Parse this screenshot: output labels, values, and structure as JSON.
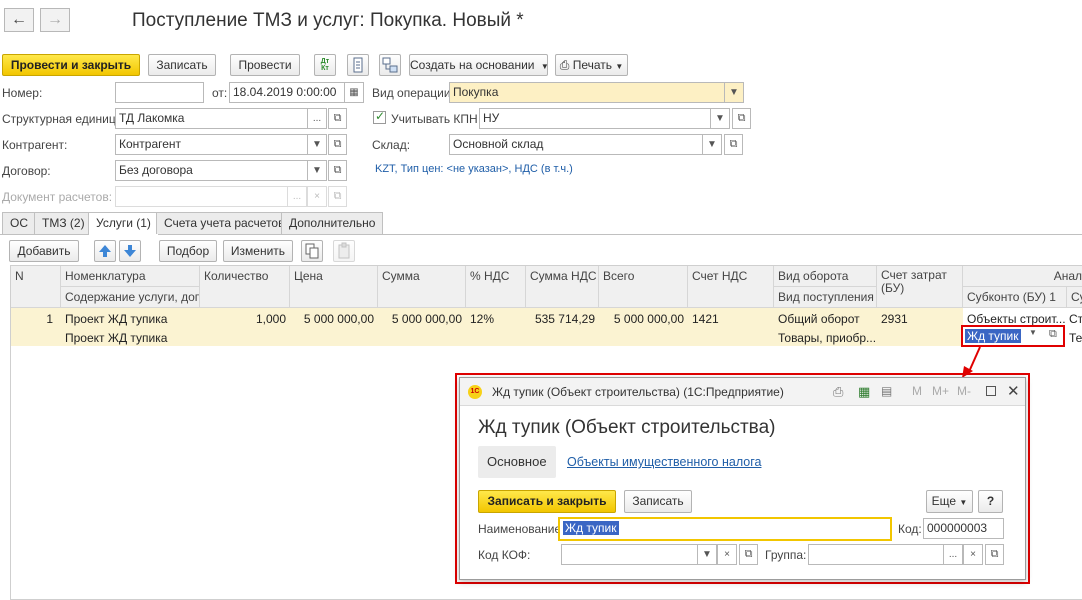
{
  "window": {
    "title": "Поступление ТМЗ и услуг: Покупка. Новый *",
    "back": "←",
    "forward": "→"
  },
  "toolbar": {
    "post_close": "Провести и закрыть",
    "save": "Записать",
    "post": "Провести",
    "dtkt": "Дт Кт",
    "create_based": "Создать на основании",
    "print": "Печать"
  },
  "form": {
    "number_label": "Номер:",
    "number_value": "",
    "date_label": "от:",
    "date_value": "18.04.2019  0:00:00",
    "op_label": "Вид операции:",
    "op_value": "Покупка",
    "unit_label": "Структурная единица:",
    "unit_value": "ТД Лакомка",
    "kpn_label": "Учитывать КПН",
    "kpn_value": "НУ",
    "counterparty_label": "Контрагент:",
    "counterparty_value": "Контрагент",
    "warehouse_label": "Склад:",
    "warehouse_value": "Основной склад",
    "contract_label": "Договор:",
    "contract_value": "Без договора",
    "currency_link": "KZT, Тип цен: <не указан>, НДС (в т.ч.)",
    "settlement_label": "Документ расчетов:",
    "settlement_value": ""
  },
  "tabs": [
    "ОС",
    "ТМЗ (2)",
    "Услуги (1)",
    "Счета учета расчетов",
    "Дополнительно"
  ],
  "table_toolbar": {
    "add": "Добавить",
    "select": "Подбор",
    "change": "Изменить"
  },
  "table": {
    "headers": {
      "n": "N",
      "nomenclature": "Номенклатура",
      "content": "Содержание услуги, доп.",
      "qty": "Количество",
      "price": "Цена",
      "sum": "Сумма",
      "vat_pct": "% НДС",
      "vat_sum": "Сумма НДС",
      "total": "Всего",
      "vat_account": "Счет НДС",
      "turnover": "Вид оборота",
      "receipt": "Вид поступления",
      "cost_account": "Счет затрат (БУ)",
      "subconto": "Субконто (БУ) 1",
      "analytics": "Анал",
      "sub2": "Су"
    },
    "row": {
      "n": "1",
      "nomenclature": "Проект ЖД тупика",
      "content": "Проект ЖД тупика",
      "qty": "1,000",
      "price": "5 000 000,00",
      "sum": "5 000 000,00",
      "vat_pct": "12%",
      "vat_sum": "535 714,29",
      "total": "5 000 000,00",
      "vat_account": "1421",
      "turnover": "Общий оборот",
      "receipt": "Товары, приобр...",
      "cost_account": "2931",
      "subconto_top": "Объекты строит...",
      "subconto_value": "Жд тупик",
      "extra_top": "Ст",
      "extra_bottom": "Те"
    }
  },
  "dialog": {
    "window_title": "Жд тупик (Объект строительства)  (1С:Предприятие)",
    "heading": "Жд тупик (Объект строительства)",
    "tab_main": "Основное",
    "tab_link": "Объекты имущественного налога",
    "save_close": "Записать и закрыть",
    "save": "Записать",
    "more": "Еще",
    "help": "?",
    "name_label": "Наименование:",
    "name_value": "Жд тупик",
    "code_label": "Код:",
    "code_value": "000000003",
    "kof_label": "Код КОФ:",
    "kof_value": "",
    "group_label": "Группа:",
    "group_value": "",
    "title_icons": [
      "M",
      "M+",
      "M-"
    ]
  },
  "colors": {
    "accent_yellow": "#f7d117",
    "highlight_red": "#e00000",
    "row_bg": "#fbf3d2",
    "link": "#1f5ea8"
  }
}
